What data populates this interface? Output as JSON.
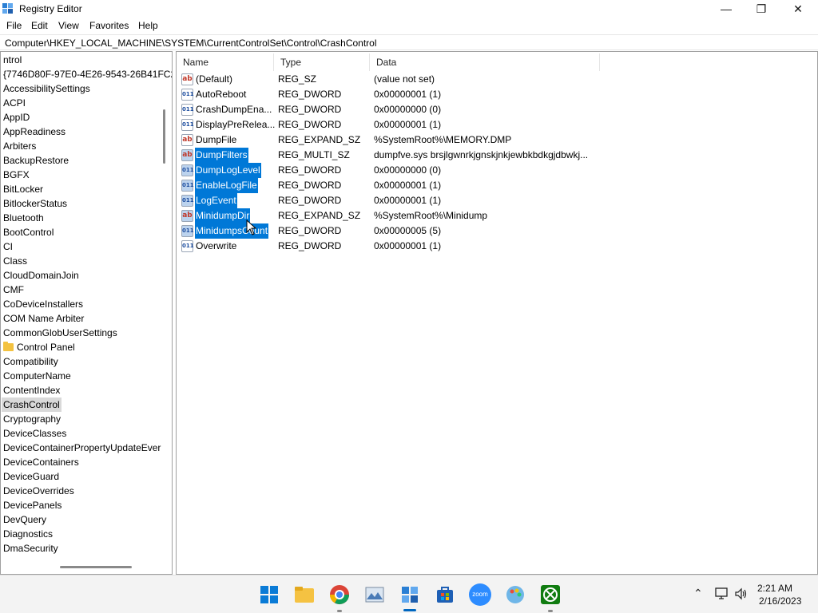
{
  "window": {
    "title": "Registry Editor"
  },
  "menu": [
    "File",
    "Edit",
    "View",
    "Favorites",
    "Help"
  ],
  "address": "Computer\\HKEY_LOCAL_MACHINE\\SYSTEM\\CurrentControlSet\\Control\\CrashControl",
  "tree": {
    "items": [
      {
        "label": "ntrol"
      },
      {
        "label": "{7746D80F-97E0-4E26-9543-26B41FC2"
      },
      {
        "label": "AccessibilitySettings"
      },
      {
        "label": "ACPI"
      },
      {
        "label": "AppID"
      },
      {
        "label": "AppReadiness"
      },
      {
        "label": "Arbiters"
      },
      {
        "label": "BackupRestore"
      },
      {
        "label": "BGFX"
      },
      {
        "label": "BitLocker"
      },
      {
        "label": "BitlockerStatus"
      },
      {
        "label": "Bluetooth"
      },
      {
        "label": "BootControl"
      },
      {
        "label": "CI"
      },
      {
        "label": "Class"
      },
      {
        "label": "CloudDomainJoin"
      },
      {
        "label": "CMF"
      },
      {
        "label": "CoDeviceInstallers"
      },
      {
        "label": "COM Name Arbiter"
      },
      {
        "label": "CommonGlobUserSettings"
      },
      {
        "label": "Control Panel",
        "icon": "folder-icon"
      },
      {
        "label": "Compatibility"
      },
      {
        "label": "ComputerName"
      },
      {
        "label": "ContentIndex"
      },
      {
        "label": "CrashControl",
        "selected": true
      },
      {
        "label": "Cryptography"
      },
      {
        "label": "DeviceClasses"
      },
      {
        "label": "DeviceContainerPropertyUpdateEver"
      },
      {
        "label": "DeviceContainers"
      },
      {
        "label": "DeviceGuard"
      },
      {
        "label": "DeviceOverrides"
      },
      {
        "label": "DevicePanels"
      },
      {
        "label": "DevQuery"
      },
      {
        "label": "Diagnostics"
      },
      {
        "label": "DmaSecurity"
      }
    ]
  },
  "values": {
    "columns": [
      "Name",
      "Type",
      "Data"
    ],
    "rows": [
      {
        "name": "(Default)",
        "type": "REG_SZ",
        "data": "(value not set)",
        "icon": "string-value-icon",
        "selected": false
      },
      {
        "name": "AutoReboot",
        "type": "REG_DWORD",
        "data": "0x00000001 (1)",
        "icon": "binary-value-icon",
        "selected": false
      },
      {
        "name": "CrashDumpEna...",
        "type": "REG_DWORD",
        "data": "0x00000000 (0)",
        "icon": "binary-value-icon",
        "selected": false
      },
      {
        "name": "DisplayPreRelea...",
        "type": "REG_DWORD",
        "data": "0x00000001 (1)",
        "icon": "binary-value-icon",
        "selected": false
      },
      {
        "name": "DumpFile",
        "type": "REG_EXPAND_SZ",
        "data": "%SystemRoot%\\MEMORY.DMP",
        "icon": "string-value-icon",
        "selected": false
      },
      {
        "name": "DumpFilters",
        "type": "REG_MULTI_SZ",
        "data": "dumpfve.sys brsjlgwnrkjgnskjnkjewbkbdkgjdbwkj...",
        "icon": "string-value-icon",
        "selected": true
      },
      {
        "name": "DumpLogLevel",
        "type": "REG_DWORD",
        "data": "0x00000000 (0)",
        "icon": "binary-value-icon",
        "selected": true
      },
      {
        "name": "EnableLogFile",
        "type": "REG_DWORD",
        "data": "0x00000001 (1)",
        "icon": "binary-value-icon",
        "selected": true
      },
      {
        "name": "LogEvent",
        "type": "REG_DWORD",
        "data": "0x00000001 (1)",
        "icon": "binary-value-icon",
        "selected": true
      },
      {
        "name": "MinidumpDir",
        "type": "REG_EXPAND_SZ",
        "data": "%SystemRoot%\\Minidump",
        "icon": "string-value-icon",
        "selected": true
      },
      {
        "name": "MinidumpsCount",
        "type": "REG_DWORD",
        "data": "0x00000005 (5)",
        "icon": "binary-value-icon",
        "selected": true
      },
      {
        "name": "Overwrite",
        "type": "REG_DWORD",
        "data": "0x00000001 (1)",
        "icon": "binary-value-icon",
        "selected": false
      }
    ]
  },
  "taskbar": {
    "icons": [
      "start-icon",
      "file-explorer-icon",
      "chrome-icon",
      "photos-icon",
      "registry-editor-icon",
      "store-icon",
      "zoom-icon",
      "paint-icon",
      "xbox-icon"
    ],
    "zoom_label": "zoom",
    "time": "2:21 AM",
    "date": "2/16/2023"
  },
  "colors": {
    "selection": "#0078d7",
    "taskbar": "#f3f3f3",
    "accent": "#0067c0"
  }
}
